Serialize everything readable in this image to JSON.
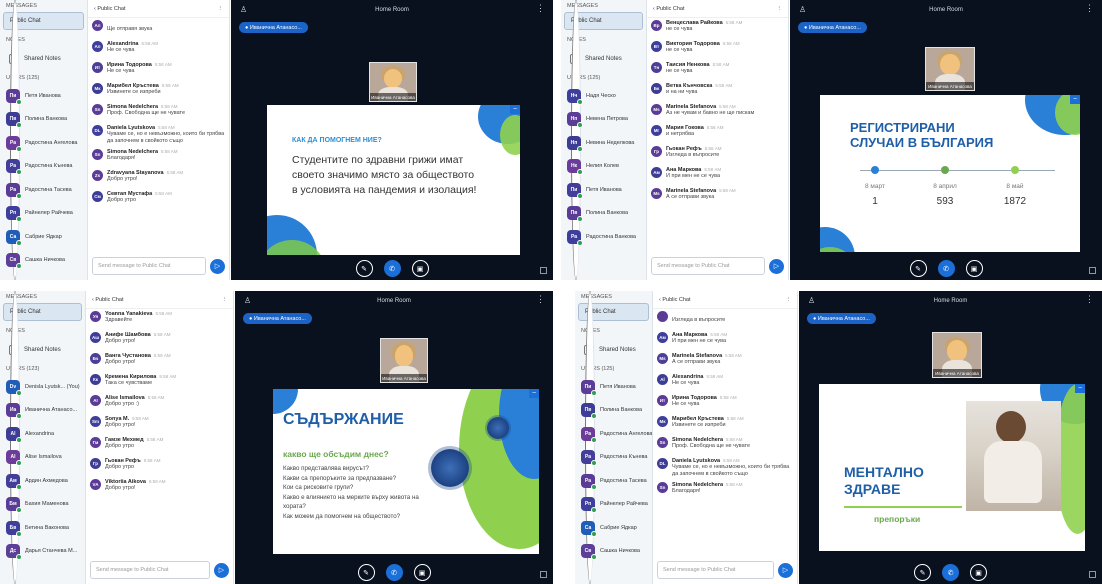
{
  "q1": {
    "nav": {
      "messages": "MESSAGES",
      "public_chat": "Public Chat",
      "notes": "NOTES",
      "shared_notes": "Shared Notes",
      "users_label": "USERS (125)",
      "users": [
        {
          "init": "Пи",
          "name": "Петя Иванова",
          "color": "#5b3d98"
        },
        {
          "init": "Пв",
          "name": "Полина Ванкова",
          "color": "#3d3d96"
        },
        {
          "init": "Ра",
          "name": "Радостина Ангелова",
          "color": "#6b3c9a"
        },
        {
          "init": "Ра",
          "name": "Радостина Кънева",
          "color": "#433e99"
        },
        {
          "init": "Ра",
          "name": "Радостина Тасева",
          "color": "#5a3c97"
        },
        {
          "init": "Рп",
          "name": "Райнелер Райчева",
          "color": "#3e3f9c"
        },
        {
          "init": "Са",
          "name": "Сабрие Ядкар",
          "color": "#1f5db8"
        },
        {
          "init": "Св",
          "name": "Сашка Ничкова",
          "color": "#5d3f97"
        }
      ]
    },
    "chat": {
      "title": "Public Chat",
      "placeholder": "Send message to Public Chat",
      "messages": [
        {
          "init": "Ал",
          "name": "",
          "time": "",
          "text": "Ще отправя звука",
          "color": "#5a3c97"
        },
        {
          "init": "Ал",
          "name": "Alexandrina",
          "time": "5:58 AM",
          "text": "Не се чува",
          "color": "#3e3f9c"
        },
        {
          "init": "Ит",
          "name": "Ирина Тодорова",
          "time": "5:58 AM",
          "text": "Не се чува",
          "color": "#4d3f95"
        },
        {
          "init": "Мк",
          "name": "Марибел Кръстева",
          "time": "5:58 AM",
          "text": "Извинете се изпреби",
          "color": "#3d3d96"
        },
        {
          "init": "Sn",
          "name": "Simona Nedelchera",
          "time": "5:58 AM",
          "text": "Проф. Свободна ще не чувате",
          "color": "#5a3c97"
        },
        {
          "init": "DL",
          "name": "Daniela Lyutskova",
          "time": "5:58 AM",
          "text": "Чуваме се, но е невъзможно, които би трябва да започнем в свойкото също",
          "color": "#3e3f9c"
        },
        {
          "init": "Sn",
          "name": "Simona Nedelchera",
          "time": "5:58 AM",
          "text": "Благодаря!",
          "color": "#5a3c97"
        },
        {
          "init": "Zs",
          "name": "Zdravyana Stayanova",
          "time": "5:58 AM",
          "text": "Добро утро!",
          "color": "#5b3d98"
        },
        {
          "init": "См",
          "name": "Севтап Мустафа",
          "time": "5:58 AM",
          "text": "Добро утро",
          "color": "#3d3d96"
        }
      ]
    },
    "room": "Home Room",
    "presenter": "Иванична Атанасо...",
    "cam_label": "Иванична Атанасова",
    "slide": {
      "kicker": "КАК ДА ПОМОГНЕМ НИЕ?",
      "body": "Студентите по здравни грижи имат своето значимо място за обществото в условията на пандемия и изолация!"
    }
  },
  "q2": {
    "nav": {
      "messages": "MESSAGES",
      "public_chat": "Public Chat",
      "notes": "NOTES",
      "shared_notes": "Shared Notes",
      "users_label": "USERS (125)",
      "users": [
        {
          "init": "Нч",
          "name": "Надя Ческо",
          "color": "#3e3f9c"
        },
        {
          "init": "Нп",
          "name": "Невена Петрова",
          "color": "#5b3d98"
        },
        {
          "init": "Нп",
          "name": "Невина Неделкова",
          "color": "#3d3d96"
        },
        {
          "init": "Нк",
          "name": "Нелия Колев",
          "color": "#6b3c9a"
        },
        {
          "init": "Пи",
          "name": "Петя Иванова",
          "color": "#433e99"
        },
        {
          "init": "Пв",
          "name": "Полина Ванкова",
          "color": "#5a3c97"
        },
        {
          "init": "Ра",
          "name": "Радостина Ванкова",
          "color": "#3e3f9c"
        }
      ]
    },
    "chat": {
      "title": "Public Chat",
      "placeholder": "Send message to Public Chat",
      "messages": [
        {
          "init": "Вр",
          "name": "Венцеслава Райкова",
          "time": "5:58 AM",
          "text": "не се чува",
          "color": "#5a3c97"
        },
        {
          "init": "Вт",
          "name": "Виктория Тодорова",
          "time": "5:58 AM",
          "text": "не се чува",
          "color": "#3e3f9c"
        },
        {
          "init": "Тн",
          "name": "Таисия Ненкова",
          "time": "5:58 AM",
          "text": "не се чува",
          "color": "#4d3f95"
        },
        {
          "init": "Бк",
          "name": "Ветка Кънчовска",
          "time": "5:58 AM",
          "text": "и на ни чува",
          "color": "#3d3d96"
        },
        {
          "init": "Ms",
          "name": "Marinela Stefanova",
          "time": "5:58 AM",
          "text": "Аз не чувам и бавно не ще пискам",
          "color": "#5a3c97"
        },
        {
          "init": "Мг",
          "name": "Мария Гокова",
          "time": "5:58 AM",
          "text": "и нетрябва",
          "color": "#3e3f9c"
        },
        {
          "init": "Гр",
          "name": "Гьокан Рефъ",
          "time": "5:58 AM",
          "text": "Изгледа в въпросите",
          "color": "#5b3d98"
        },
        {
          "init": "Ам",
          "name": "Ана Маркова",
          "time": "5:58 AM",
          "text": "И при мен не се чува",
          "color": "#3d3d96"
        },
        {
          "init": "Ms",
          "name": "Marinela Stefanova",
          "time": "5:58 AM",
          "text": "А се отправи звука",
          "color": "#5a3c97"
        }
      ]
    },
    "room": "Home Room",
    "presenter": "Иванична Атанасо...",
    "cam_label": "Иванична Атанасова",
    "slide": {
      "title": "РЕГИСТРИРАНИ СЛУЧАИ В БЪЛГАРИЯ",
      "dates": [
        "8 март",
        "8 април",
        "8 май"
      ],
      "values": [
        "1",
        "593",
        "1872"
      ]
    }
  },
  "q3": {
    "nav": {
      "messages": "MESSAGES",
      "public_chat": "Public Chat",
      "notes": "NOTES",
      "shared_notes": "Shared Notes",
      "users_label": "USERS (123)",
      "users": [
        {
          "init": "Dv",
          "name": "Denisla Lyutsk... (You)",
          "color": "#1f5db8"
        },
        {
          "init": "Иа",
          "name": "Иванична Атанасо...",
          "color": "#5b3d98"
        },
        {
          "init": "Al",
          "name": "Alexandrina",
          "color": "#3d3d96"
        },
        {
          "init": "AI",
          "name": "Alise Ismailova",
          "color": "#6b3c9a"
        },
        {
          "init": "Ам",
          "name": "Ардин Ахмедова",
          "color": "#433e99"
        },
        {
          "init": "Бм",
          "name": "Бахия Маменова",
          "color": "#5a3c97"
        },
        {
          "init": "Бв",
          "name": "Бетина Ваконова",
          "color": "#3e3f9c"
        },
        {
          "init": "Дс",
          "name": "Дарья Станчева М...",
          "color": "#5d3f97"
        }
      ]
    },
    "chat": {
      "title": "Public Chat",
      "placeholder": "Send message to Public Chat",
      "messages": [
        {
          "init": "Уя",
          "name": "Yoanna Yanakieva",
          "time": "5:58 AM",
          "text": "Здравейте",
          "color": "#5a3c97"
        },
        {
          "init": "Аш",
          "name": "Анифе Шамбова",
          "time": "5:58 AM",
          "text": "Добро утро!",
          "color": "#3e3f9c"
        },
        {
          "init": "Бч",
          "name": "Ванга Чустанова",
          "time": "5:58 AM",
          "text": "Добро утро!",
          "color": "#4d3f95"
        },
        {
          "init": "Кк",
          "name": "Кремена Кирилова",
          "time": "5:58 AM",
          "text": "Така се чувстваме",
          "color": "#3d3d96"
        },
        {
          "init": "AI",
          "name": "Alise Ismailova",
          "time": "5:58 AM",
          "text": "Добро утро :)",
          "color": "#5a3c97"
        },
        {
          "init": "Sm",
          "name": "Sonya M.",
          "time": "5:58 AM",
          "text": "Добро утро!",
          "color": "#3e3f9c"
        },
        {
          "init": "Гм",
          "name": "Гамзе Мехмед",
          "time": "5:58 AM",
          "text": "Добро утро",
          "color": "#5b3d98"
        },
        {
          "init": "Гр",
          "name": "Гьокан Рефъ",
          "time": "5:58 AM",
          "text": "Добро утро",
          "color": "#3d3d96"
        },
        {
          "init": "VA",
          "name": "Viktoriia Aikova",
          "time": "5:58 AM",
          "text": "Добро утро!",
          "color": "#5a3c97"
        }
      ]
    },
    "room": "Home Room",
    "presenter": "Иванична Атанасо...",
    "cam_label": "Иванична Атанасова",
    "slide": {
      "title": "СЪДЪРЖАНИЕ",
      "subtitle": "какво ще обсъдим днес?",
      "items": [
        "Какво представлява вирусът?",
        "Какви са препоръките за предпазване?",
        "Кои са рисковите групи?",
        "Какво е влиянието на мерките върху живота на хората?",
        "Как можем да помогнем на обществото?"
      ]
    }
  },
  "q4": {
    "nav": {
      "messages": "MESSAGES",
      "public_chat": "Public Chat",
      "notes": "NOTES",
      "shared_notes": "Shared Notes",
      "users_label": "USERS (125)",
      "users": [
        {
          "init": "Пи",
          "name": "Петя Иванова",
          "color": "#5b3d98"
        },
        {
          "init": "Пв",
          "name": "Полина Ванкова",
          "color": "#3d3d96"
        },
        {
          "init": "Ра",
          "name": "Радостина Ангелова",
          "color": "#6b3c9a"
        },
        {
          "init": "Ра",
          "name": "Радостина Кънева",
          "color": "#433e99"
        },
        {
          "init": "Ра",
          "name": "Радостина Тасева",
          "color": "#5a3c97"
        },
        {
          "init": "Рп",
          "name": "Райнелер Райчева",
          "color": "#3e3f9c"
        },
        {
          "init": "Са",
          "name": "Сабрие Ядкар",
          "color": "#1f5db8"
        },
        {
          "init": "Св",
          "name": "Сашка Ничкова",
          "color": "#5d3f97"
        }
      ]
    },
    "chat": {
      "title": "Public Chat",
      "placeholder": "Send message to Public Chat",
      "messages": [
        {
          "init": "",
          "name": "",
          "time": "",
          "text": "Изгледа в въпросите",
          "color": "#5a3c97"
        },
        {
          "init": "Ам",
          "name": "Ана Маркова",
          "time": "5:58 AM",
          "text": "И при мен не се чува",
          "color": "#3e3f9c"
        },
        {
          "init": "Ms",
          "name": "Marinela Stefanova",
          "time": "5:58 AM",
          "text": "А се отправи звука",
          "color": "#4d3f95"
        },
        {
          "init": "Al",
          "name": "Alexandrina",
          "time": "5:58 AM",
          "text": "Не се чува",
          "color": "#3d3d96"
        },
        {
          "init": "Ит",
          "name": "Ирина Тодорова",
          "time": "5:58 AM",
          "text": "Не се чува",
          "color": "#5a3c97"
        },
        {
          "init": "Мк",
          "name": "Марибел Кръстева",
          "time": "5:58 AM",
          "text": "Извинете се изпреби",
          "color": "#3e3f9c"
        },
        {
          "init": "Sn",
          "name": "Simona Nedelchera",
          "time": "5:58 AM",
          "text": "Проф. Свободна ще не чувате",
          "color": "#5b3d98"
        },
        {
          "init": "DL",
          "name": "Daniela Lyutskova",
          "time": "5:58 AM",
          "text": "Чуваме се, но е невъзможно, които би трябва да започнем в свойкото също",
          "color": "#3d3d96"
        },
        {
          "init": "Sn",
          "name": "Simona Nedelchera",
          "time": "5:58 AM",
          "text": "Благодаря!",
          "color": "#5a3c97"
        }
      ]
    },
    "room": "Home Room",
    "presenter": "Иванична Атанасо...",
    "cam_label": "Иванична Атанасова",
    "slide": {
      "title": "МЕНТАЛНО ЗДРАВЕ",
      "subtitle": "препоръки"
    }
  }
}
